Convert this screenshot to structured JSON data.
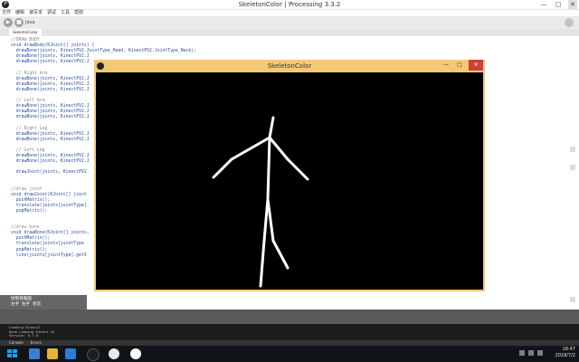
{
  "ide": {
    "title": "SkeletonColor | Processing 3.3.2",
    "menu": [
      "文件",
      "编辑",
      "速写本",
      "调试",
      "工具",
      "帮助"
    ],
    "mode": "Java",
    "tab": "SkeletonColor"
  },
  "code_lines": [
    "//DRAW BODY",
    "void drawBody(KJoint[] joints) {",
    "  drawBone(joints, KinectPV2.JointType_Head, KinectPV2.JointType_Neck);",
    "  drawBone(joints, KinectPV2.J",
    "  drawBone(joints, KinectPV2.J",
    "",
    "  // Right Arm",
    "  drawBone(joints, KinectPV2.J",
    "  drawBone(joints, KinectPV2.J",
    "  drawBone(joints, KinectPV2.J",
    "",
    "  // Left Arm",
    "  drawBone(joints, KinectPV2.J",
    "  drawBone(joints, KinectPV2.J",
    "  drawBone(joints, KinectPV2.J",
    "",
    "  // Right Leg",
    "  drawBone(joints, KinectPV2.J",
    "  drawBone(joints, KinectPV2.J",
    "",
    "  // Left Leg",
    "  drawBone(joints, KinectPV2.J",
    "  drawBone(joints, KinectPV2.J",
    "",
    "  drawJoint(joints, KinectPV2.",
    "",
    "",
    "//draw joint",
    "void drawJoint(KJoint[] joint",
    "  pushMatrix();",
    "  translate(joints[jointType].",
    "  popMatrix();",
    "",
    "",
    "//draw bone",
    "void drawBone(KJoint[] joints,",
    "  pushMatrix();",
    "  translate(joints[jointType",
    "  popMatrix();",
    "  line(joints[jointType].getX"
  ],
  "footer_lines": [
    "绘制骨骼图",
    "左手 右手 状态"
  ],
  "console_lines": [
    "Loading Kinect2",
    "Done Loading Kinect V2",
    "Version: 0.7.8"
  ],
  "console_tabs": [
    "Console",
    "Errors"
  ],
  "sketch": {
    "title": "SkeletonColor",
    "min": "—",
    "max": "□",
    "close": "✕"
  },
  "taskbar": {
    "time": "18:47",
    "date": "2018/7/2"
  },
  "colors": {
    "sketch_frame": "#f3c876",
    "canvas": "#000000",
    "skeleton": "#ffffff",
    "close_red": "#c8423a"
  }
}
